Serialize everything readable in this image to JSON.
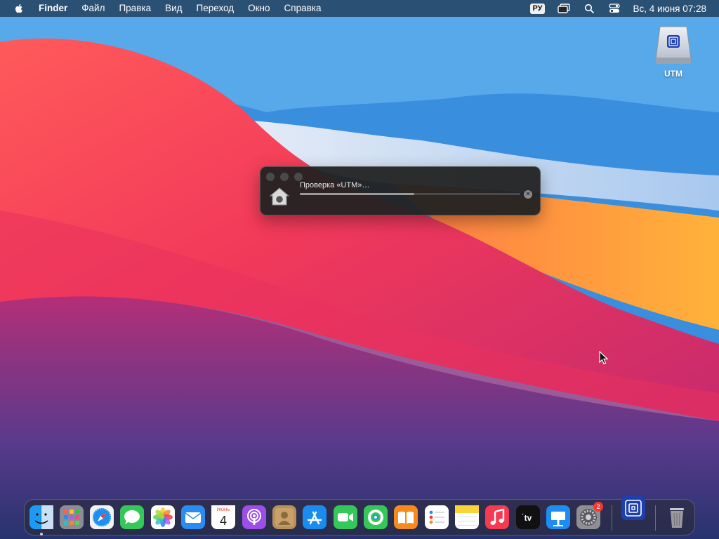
{
  "menubar": {
    "apple_icon": "apple-logo-icon",
    "app_name": "Finder",
    "menus": [
      "Файл",
      "Правка",
      "Вид",
      "Переход",
      "Окно",
      "Справка"
    ],
    "input_source": "РУ",
    "clock": "Вс, 4 июня  07:28"
  },
  "desktop": {
    "disk_label": "UTM"
  },
  "progress_panel": {
    "message": "Проверка «UTM»…",
    "progress": 0.52
  },
  "dock": {
    "apps": [
      {
        "name": "Finder",
        "icon": "finder-icon",
        "running": true
      },
      {
        "name": "Launchpad",
        "icon": "launchpad-icon"
      },
      {
        "name": "Safari",
        "icon": "safari-icon"
      },
      {
        "name": "Messages",
        "icon": "messages-icon"
      },
      {
        "name": "Photos",
        "icon": "photos-icon"
      },
      {
        "name": "Mail",
        "icon": "mail-icon"
      },
      {
        "name": "Calendar",
        "icon": "calendar-icon",
        "month": "ИЮНЬ",
        "day": "4"
      },
      {
        "name": "Podcasts",
        "icon": "podcasts-icon"
      },
      {
        "name": "Contacts",
        "icon": "contacts-icon"
      },
      {
        "name": "App Store",
        "icon": "app-store-icon"
      },
      {
        "name": "FaceTime",
        "icon": "facetime-icon"
      },
      {
        "name": "Find My",
        "icon": "find-my-icon"
      },
      {
        "name": "Books",
        "icon": "books-icon"
      },
      {
        "name": "Reminders",
        "icon": "reminders-icon"
      },
      {
        "name": "Notes",
        "icon": "notes-icon"
      },
      {
        "name": "Music",
        "icon": "music-icon"
      },
      {
        "name": "TV",
        "icon": "tv-icon",
        "label": "tv"
      },
      {
        "name": "Keynote",
        "icon": "keynote-icon"
      },
      {
        "name": "System Preferences",
        "icon": "system-preferences-icon",
        "badge": "2"
      },
      {
        "name": "UTM",
        "icon": "utm-icon"
      },
      {
        "name": "Trash",
        "icon": "trash-icon"
      }
    ]
  }
}
